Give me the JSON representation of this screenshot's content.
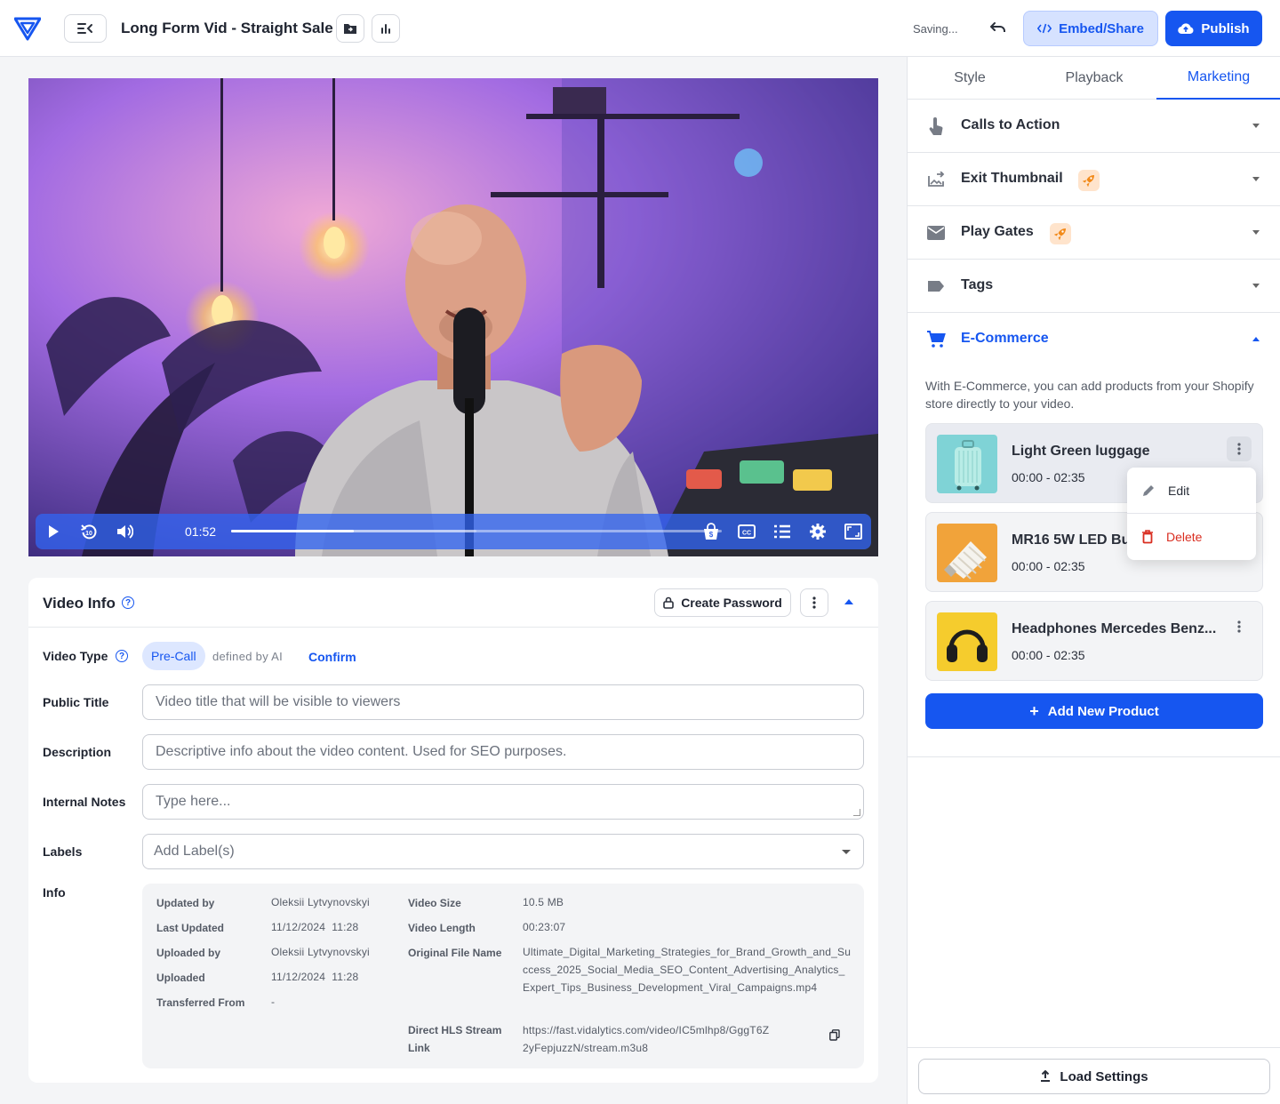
{
  "header": {
    "title": "Long Form Vid - Straight Sale",
    "status": "Saving...",
    "embed_label": "Embed/Share",
    "publish_label": "Publish"
  },
  "player": {
    "current_time": "01:52",
    "progress": 0.25,
    "buffered": 0.5
  },
  "video_info": {
    "title": "Video Info",
    "create_password": "Create Password",
    "video_type_label": "Video Type",
    "video_type_value": "Pre-Call",
    "defined_by": "defined by AI",
    "confirm": "Confirm",
    "public_title_label": "Public Title",
    "public_title_placeholder": "Video title that will be visible to viewers",
    "description_label": "Description",
    "description_placeholder": "Descriptive info about the video content. Used for SEO purposes.",
    "notes_label": "Internal Notes",
    "notes_placeholder": "Type here...",
    "labels_label": "Labels",
    "labels_placeholder": "Add Label(s)",
    "info_label": "Info",
    "info": {
      "updated_by_k": "Updated by",
      "updated_by_v": "Oleksii Lytvynovskyi",
      "last_updated_k": "Last Updated",
      "last_updated_v": "11/12/2024  11:28",
      "uploaded_by_k": "Uploaded by",
      "uploaded_by_v": "Oleksii Lytvynovskyi",
      "uploaded_k": "Uploaded",
      "uploaded_v": "11/12/2024  11:28",
      "transferred_k": "Transferred From",
      "transferred_v": "-",
      "size_k": "Video Size",
      "size_v": "10.5 MB",
      "length_k": "Video Length",
      "length_v": "00:23:07",
      "filename_k": "Original File Name",
      "filename_v": "Ultimate_Digital_Marketing_Strategies_for_Brand_Growth_and_Success_2025_Social_Media_SEO_Content_Advertising_Analytics_Expert_Tips_Business_Development_Viral_Campaigns.mp4",
      "hls_k": "Direct HLS Stream Link",
      "hls_v": "https://fast.vidalytics.com/video/IC5mlhp8/GggT6Z2yFepjuzzN/stream.m3u8"
    }
  },
  "panel": {
    "tabs": [
      "Style",
      "Playback",
      "Marketing"
    ],
    "active_tab": "Marketing",
    "sections": {
      "cta": "Calls to Action",
      "exit": "Exit Thumbnail",
      "gates": "Play Gates",
      "tags": "Tags",
      "ecom": "E-Commerce"
    },
    "ecom_desc": "With E-Commerce, you can add products from your Shopify store directly to your video.",
    "products": [
      {
        "name": "Light Green luggage",
        "time": "00:00 - 02:35"
      },
      {
        "name": "MR16 5W LED Bu",
        "time": "00:00 - 02:35"
      },
      {
        "name": "Headphones Mercedes Benz...",
        "time": "00:00 - 02:35"
      }
    ],
    "menu": {
      "edit": "Edit",
      "delete": "Delete"
    },
    "add_product": "Add New Product",
    "load_settings": "Load Settings"
  },
  "colors": {
    "accent": "#1656f0",
    "danger": "#d92d20",
    "pro_badge": "#ffe4cc"
  }
}
